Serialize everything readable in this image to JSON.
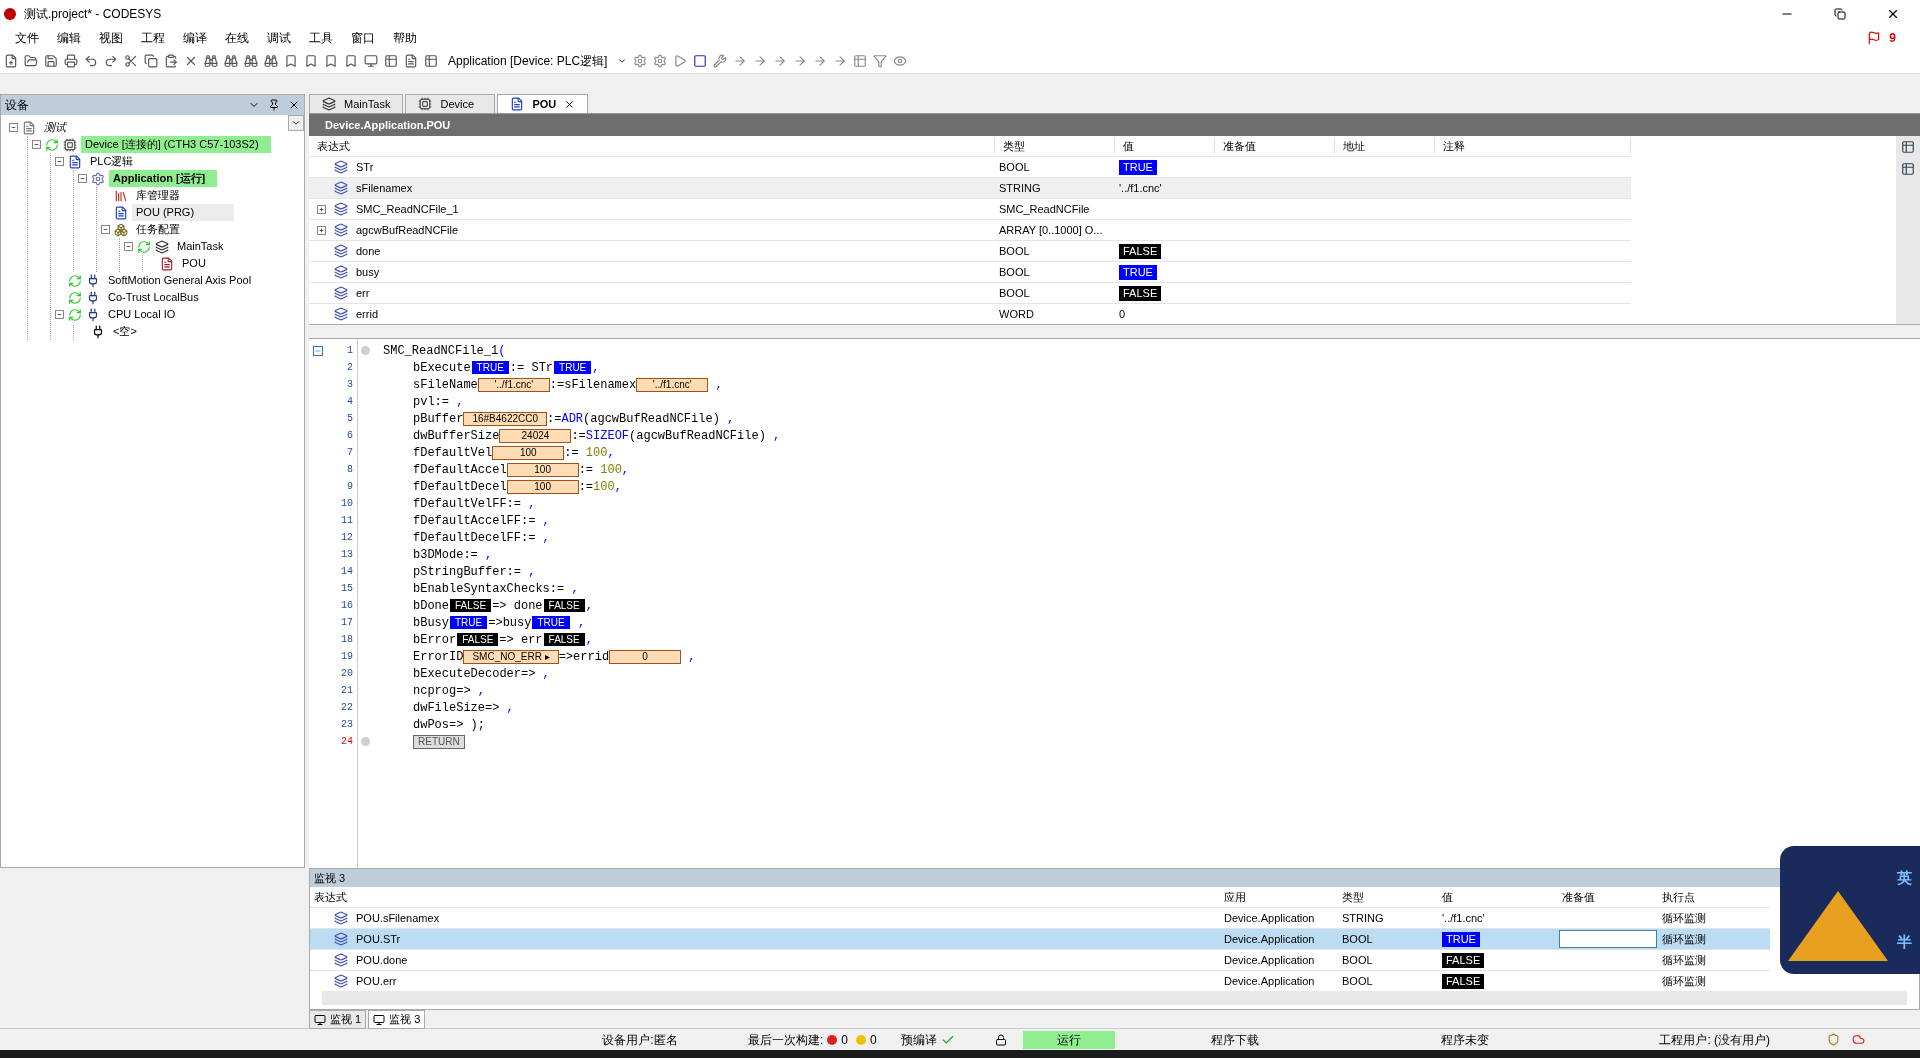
{
  "window": {
    "title": "测试.project* - CODESYS",
    "alert_count": "9"
  },
  "menu": [
    "文件",
    "编辑",
    "视图",
    "工程",
    "编译",
    "在线",
    "调试",
    "工具",
    "窗口",
    "帮助"
  ],
  "toolbar": {
    "app_selector": "Application [Device: PLC逻辑]"
  },
  "devices_panel": {
    "title": "设备",
    "tree": [
      {
        "label": "测试",
        "kind": "project",
        "expanded": true,
        "children": [
          {
            "label": "Device [连接的] (CTH3 C57-103S2)",
            "kind": "device",
            "expanded": true,
            "highlighted": true,
            "children": [
              {
                "label": "PLC逻辑",
                "kind": "plc",
                "expanded": true,
                "children": [
                  {
                    "label": "Application [运行]",
                    "kind": "app",
                    "expanded": true,
                    "highlighted": true,
                    "bold": true,
                    "children": [
                      {
                        "label": "库管理器",
                        "kind": "library"
                      },
                      {
                        "label": "POU (PRG)",
                        "kind": "pou",
                        "selected": true
                      },
                      {
                        "label": "任务配置",
                        "kind": "taskconfig",
                        "expanded": true,
                        "children": [
                          {
                            "label": "MainTask",
                            "kind": "task",
                            "expanded": true,
                            "children": [
                              {
                                "label": "POU",
                                "kind": "call"
                              }
                            ]
                          }
                        ]
                      }
                    ]
                  }
                ]
              },
              {
                "label": "SoftMotion General Axis Pool",
                "kind": "axis"
              },
              {
                "label": "Co-Trust LocalBus",
                "kind": "axis"
              },
              {
                "label": "CPU Local IO",
                "kind": "axis",
                "expanded": true,
                "children": [
                  {
                    "label": "<空>",
                    "kind": "slot"
                  }
                ]
              }
            ]
          }
        ]
      }
    ]
  },
  "editor_tabs": [
    {
      "label": "MainTask",
      "kind": "task",
      "selected": false
    },
    {
      "label": "Device",
      "kind": "device",
      "selected": false
    },
    {
      "label": "POU",
      "kind": "pou",
      "selected": true
    }
  ],
  "pou_view": {
    "title": "Device.Application.POU",
    "columns": [
      "表达式",
      "类型",
      "值",
      "准备值",
      "地址",
      "注释"
    ],
    "rows": [
      {
        "name": "STr",
        "type": "BOOL",
        "value": {
          "kind": "bool",
          "on": true,
          "text": "TRUE"
        },
        "selected": false
      },
      {
        "name": "sFilenamex",
        "type": "STRING",
        "value": {
          "kind": "text",
          "text": "'../f1.cnc'"
        },
        "selected": true
      },
      {
        "name": "SMC_ReadNCFile_1",
        "type": "SMC_ReadNCFile",
        "expandable": true,
        "selected": false
      },
      {
        "name": "agcwBufReadNCFile",
        "type": "ARRAY [0..1000] O...",
        "expandable": true,
        "selected": false
      },
      {
        "name": "done",
        "type": "BOOL",
        "value": {
          "kind": "bool",
          "on": false,
          "text": "FALSE"
        },
        "selected": false
      },
      {
        "name": "busy",
        "type": "BOOL",
        "value": {
          "kind": "bool",
          "on": true,
          "text": "TRUE"
        },
        "selected": false
      },
      {
        "name": "err",
        "type": "BOOL",
        "value": {
          "kind": "bool",
          "on": false,
          "text": "FALSE"
        },
        "selected": false
      },
      {
        "name": "errid",
        "type": "WORD",
        "value": {
          "kind": "text",
          "text": "0"
        },
        "selected": false
      }
    ]
  },
  "code": [
    {
      "n": "1",
      "marker": true,
      "fold": true,
      "indent": false,
      "current": false,
      "segs": [
        {
          "kind": "id",
          "t": "SMC_ReadNCFile_1"
        },
        {
          "kind": "punct",
          "t": "("
        }
      ]
    },
    {
      "n": "2",
      "indent": true,
      "current": false,
      "segs": [
        {
          "kind": "id",
          "t": "bExecute"
        },
        {
          "kind": "bool",
          "on": true,
          "t": "TRUE"
        },
        {
          "kind": "id",
          "t": ":= STr"
        },
        {
          "kind": "bool",
          "on": true,
          "t": "TRUE"
        },
        {
          "kind": "punct",
          "t": ","
        }
      ]
    },
    {
      "n": "3",
      "indent": true,
      "current": false,
      "segs": [
        {
          "kind": "id",
          "t": "sFileName"
        },
        {
          "kind": "monitor",
          "t": "'../f1.cnc'"
        },
        {
          "kind": "id",
          "t": ":=sFilenamex"
        },
        {
          "kind": "monitor",
          "t": "'../f1.cnc'"
        },
        {
          "kind": "punct",
          "t": " ,"
        }
      ]
    },
    {
      "n": "4",
      "indent": true,
      "current": false,
      "segs": [
        {
          "kind": "id",
          "t": "pvl:="
        },
        {
          "kind": "punct",
          "t": " ,"
        }
      ]
    },
    {
      "n": "5",
      "indent": true,
      "current": false,
      "segs": [
        {
          "kind": "id",
          "t": "pBuffer"
        },
        {
          "kind": "monitor",
          "t": "16#B4622CC0"
        },
        {
          "kind": "id",
          "t": ":="
        },
        {
          "kind": "keyword",
          "t": "ADR"
        },
        {
          "kind": "id",
          "t": "(agcwBufReadNCFile)"
        },
        {
          "kind": "punct",
          "t": " ,"
        }
      ]
    },
    {
      "n": "6",
      "indent": true,
      "current": false,
      "segs": [
        {
          "kind": "id",
          "t": "dwBufferSize"
        },
        {
          "kind": "monitor",
          "t": "24024"
        },
        {
          "kind": "id",
          "t": ":="
        },
        {
          "kind": "keyword",
          "t": "SIZEOF"
        },
        {
          "kind": "id",
          "t": "(agcwBufReadNCFile)"
        },
        {
          "kind": "punct",
          "t": " ,"
        }
      ]
    },
    {
      "n": "7",
      "indent": true,
      "current": false,
      "segs": [
        {
          "kind": "id",
          "t": "fDefaultVel"
        },
        {
          "kind": "monitor",
          "t": "100"
        },
        {
          "kind": "id",
          "t": ":= "
        },
        {
          "kind": "number",
          "t": "100"
        },
        {
          "kind": "punct",
          "t": ","
        }
      ]
    },
    {
      "n": "8",
      "indent": true,
      "current": false,
      "segs": [
        {
          "kind": "id",
          "t": "fDefaultAccel"
        },
        {
          "kind": "monitor",
          "t": "100"
        },
        {
          "kind": "id",
          "t": ":= "
        },
        {
          "kind": "number",
          "t": "100"
        },
        {
          "kind": "punct",
          "t": ","
        }
      ]
    },
    {
      "n": "9",
      "indent": true,
      "current": false,
      "segs": [
        {
          "kind": "id",
          "t": "fDefaultDecel"
        },
        {
          "kind": "monitor",
          "t": "100"
        },
        {
          "kind": "id",
          "t": ":="
        },
        {
          "kind": "number",
          "t": "100"
        },
        {
          "kind": "punct",
          "t": ","
        }
      ]
    },
    {
      "n": "10",
      "indent": true,
      "current": false,
      "segs": [
        {
          "kind": "id",
          "t": "fDefaultVelFF:="
        },
        {
          "kind": "punct",
          "t": " ,"
        }
      ]
    },
    {
      "n": "11",
      "indent": true,
      "current": false,
      "segs": [
        {
          "kind": "id",
          "t": "fDefaultAccelFF:="
        },
        {
          "kind": "punct",
          "t": " ,"
        }
      ]
    },
    {
      "n": "12",
      "indent": true,
      "current": false,
      "segs": [
        {
          "kind": "id",
          "t": "fDefaultDecelFF:="
        },
        {
          "kind": "punct",
          "t": " ,"
        }
      ]
    },
    {
      "n": "13",
      "indent": true,
      "current": false,
      "segs": [
        {
          "kind": "id",
          "t": "b3DMode:="
        },
        {
          "kind": "punct",
          "t": " ,"
        }
      ]
    },
    {
      "n": "14",
      "indent": true,
      "current": false,
      "segs": [
        {
          "kind": "id",
          "t": "pStringBuffer:="
        },
        {
          "kind": "punct",
          "t": " ,"
        }
      ]
    },
    {
      "n": "15",
      "indent": true,
      "current": false,
      "segs": [
        {
          "kind": "id",
          "t": "bEnableSyntaxChecks:="
        },
        {
          "kind": "punct",
          "t": " ,"
        }
      ]
    },
    {
      "n": "16",
      "indent": true,
      "current": false,
      "segs": [
        {
          "kind": "id",
          "t": "bDone"
        },
        {
          "kind": "bool",
          "on": false,
          "t": "FALSE"
        },
        {
          "kind": "id",
          "t": "=> done"
        },
        {
          "kind": "bool",
          "on": false,
          "t": "FALSE"
        },
        {
          "kind": "punct",
          "t": ","
        }
      ]
    },
    {
      "n": "17",
      "indent": true,
      "current": false,
      "segs": [
        {
          "kind": "id",
          "t": "bBusy"
        },
        {
          "kind": "bool",
          "on": true,
          "t": "TRUE"
        },
        {
          "kind": "id",
          "t": "=>busy"
        },
        {
          "kind": "bool",
          "on": true,
          "t": "TRUE"
        },
        {
          "kind": "punct",
          "t": " ,"
        }
      ]
    },
    {
      "n": "18",
      "indent": true,
      "current": false,
      "segs": [
        {
          "kind": "id",
          "t": "bError"
        },
        {
          "kind": "bool",
          "on": false,
          "t": "FALSE"
        },
        {
          "kind": "id",
          "t": "=> err"
        },
        {
          "kind": "bool",
          "on": false,
          "t": "FALSE"
        },
        {
          "kind": "punct",
          "t": ","
        }
      ]
    },
    {
      "n": "19",
      "indent": true,
      "current": false,
      "segs": [
        {
          "kind": "id",
          "t": "ErrorID"
        },
        {
          "kind": "monitor",
          "t": "SMC_NO_ERR ▸"
        },
        {
          "kind": "id",
          "t": "=>errid"
        },
        {
          "kind": "monitor",
          "t": "0"
        },
        {
          "kind": "punct",
          "t": " ,"
        }
      ]
    },
    {
      "n": "20",
      "indent": true,
      "current": false,
      "segs": [
        {
          "kind": "id",
          "t": "bExecuteDecoder=>"
        },
        {
          "kind": "punct",
          "t": " ,"
        }
      ]
    },
    {
      "n": "21",
      "indent": true,
      "current": false,
      "segs": [
        {
          "kind": "id",
          "t": "ncprog=>"
        },
        {
          "kind": "punct",
          "t": " ,"
        }
      ]
    },
    {
      "n": "22",
      "indent": true,
      "current": false,
      "segs": [
        {
          "kind": "id",
          "t": "dwFileSize=>"
        },
        {
          "kind": "punct",
          "t": " ,"
        }
      ]
    },
    {
      "n": "23",
      "indent": true,
      "current": false,
      "segs": [
        {
          "kind": "id",
          "t": "dwPos=> );"
        }
      ]
    },
    {
      "n": "24",
      "marker": true,
      "indent": true,
      "current": true,
      "segs": [
        {
          "kind": "return",
          "t": "RETURN"
        }
      ]
    }
  ],
  "watch": {
    "title": "监视 3",
    "columns": [
      "表达式",
      "应用",
      "类型",
      "值",
      "准备值",
      "执行点"
    ],
    "rows": [
      {
        "expr": "POU.sFilenamex",
        "app": "Device.Application",
        "type": "STRING",
        "value": {
          "kind": "text",
          "text": "'../f1.cnc'"
        },
        "exec": "循环监测",
        "selected": false
      },
      {
        "expr": "POU.STr",
        "app": "Device.Application",
        "type": "BOOL",
        "value": {
          "kind": "bool",
          "on": true,
          "text": "TRUE"
        },
        "exec": "循环监测",
        "selected": true
      },
      {
        "expr": "POU.done",
        "app": "Device.Application",
        "type": "BOOL",
        "value": {
          "kind": "bool",
          "on": false,
          "text": "FALSE"
        },
        "exec": "循环监测",
        "selected": false
      },
      {
        "expr": "POU.err",
        "app": "Device.Application",
        "type": "BOOL",
        "value": {
          "kind": "bool",
          "on": false,
          "text": "FALSE"
        },
        "exec": "循环监测",
        "selected": false
      }
    ],
    "tabs": [
      {
        "label": "监视 1",
        "selected": false
      },
      {
        "label": "监视 3",
        "selected": true
      }
    ]
  },
  "ime": {
    "lang": "英",
    "width": "半"
  },
  "status_bar": {
    "device_user": "设备用户:匿名",
    "last_build": "最后一次构建:",
    "errors": "0",
    "warnings": "0",
    "precompile": "预编译",
    "run_state": "运行",
    "download": "程序下载",
    "changes": "程序未变",
    "project_user": "工程用户: (没有用户)"
  }
}
